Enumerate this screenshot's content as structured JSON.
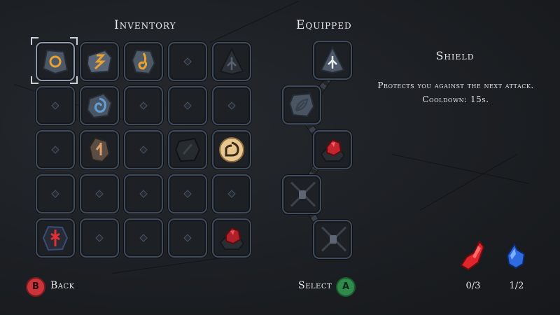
{
  "inventory": {
    "title": "Inventory"
  },
  "equipped": {
    "title": "Equipped"
  },
  "info": {
    "title": "Shield",
    "description": "Protects you against the next attack. Cooldown: 15s."
  },
  "resources": [
    {
      "icon": "red-crystal-shard-icon",
      "color": "#e0262b",
      "value": "0/3"
    },
    {
      "icon": "blue-crystal-shard-icon",
      "color": "#2f6be0",
      "value": "1/2"
    }
  ],
  "controls": {
    "back": {
      "button": "B",
      "label": "Back",
      "color": "#c9353a"
    },
    "select": {
      "button": "A",
      "label": "Select",
      "color": "#3aa15a"
    }
  },
  "colors": {
    "slot_border": "#3f4a5a",
    "background": "#1b1e22",
    "gold": "#e8a232",
    "rune_blue": "#5f9ed6",
    "rune_red": "#e03036"
  }
}
